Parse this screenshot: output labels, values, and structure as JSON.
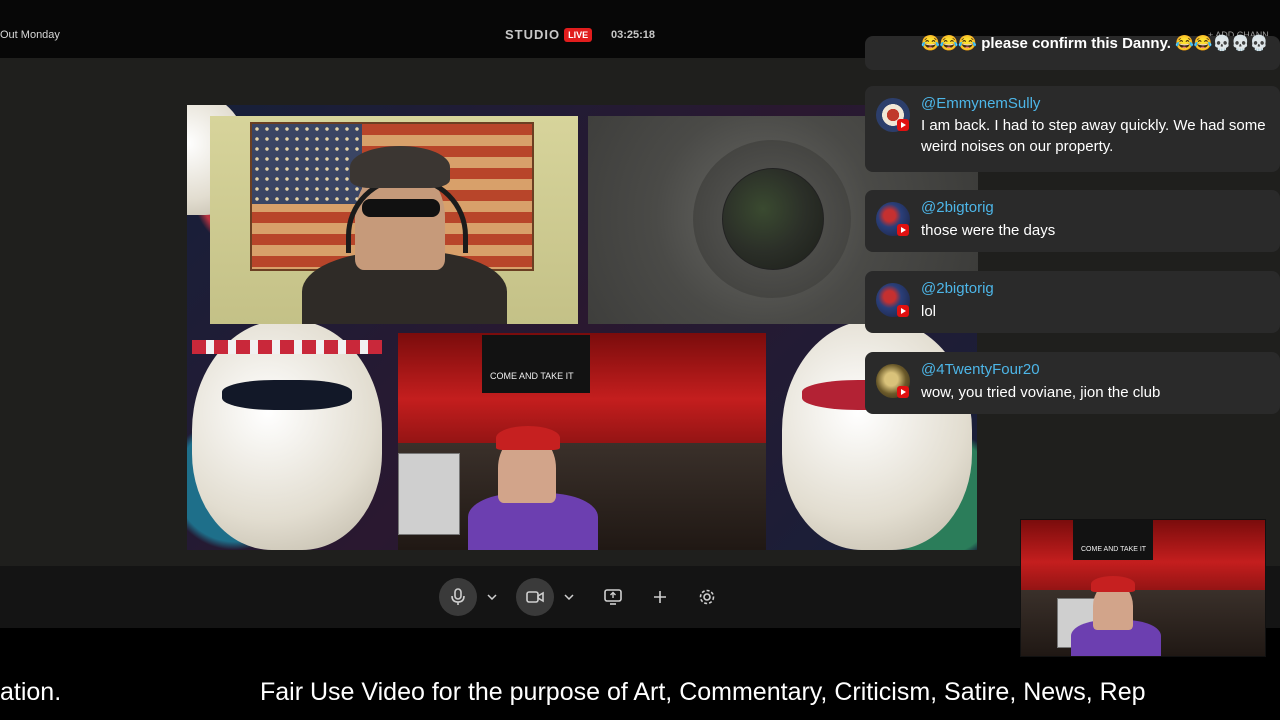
{
  "header": {
    "show_title": "Out Monday",
    "studio_label": "STUDIO",
    "live_label": "LIVE",
    "timer": "03:25:18",
    "add_channel": "+ ADD CHANN"
  },
  "stage": {
    "guest3_banner": "COME AND TAKE IT",
    "pip_banner": "COME AND TAKE IT"
  },
  "controls": {
    "mic": "microphone-icon",
    "camera": "camera-icon",
    "share": "screen-share-icon",
    "add": "plus-icon",
    "settings": "gear-icon"
  },
  "chat": {
    "messages": [
      {
        "user": "",
        "text": "😂😂😂 please confirm this Danny. 😂😂💀💀💀"
      },
      {
        "user": "@EmmynemSully",
        "text": "I am back. I had to step away quickly. We had some weird noises on our property."
      },
      {
        "user": "@2bigtorig",
        "text": "those were the days"
      },
      {
        "user": "@2bigtorig",
        "text": "lol"
      },
      {
        "user": "@4TwentyFour20",
        "text": "wow, you tried voviane, jion the club"
      }
    ]
  },
  "ticker": {
    "left_fragment": "ation.",
    "main": "Fair Use Video for the purpose of Art, Commentary, Criticism, Satire, News, Rep"
  },
  "colors": {
    "live": "#e11d1d",
    "username": "#4db6e8",
    "chat_card": "#2a2a2a"
  }
}
